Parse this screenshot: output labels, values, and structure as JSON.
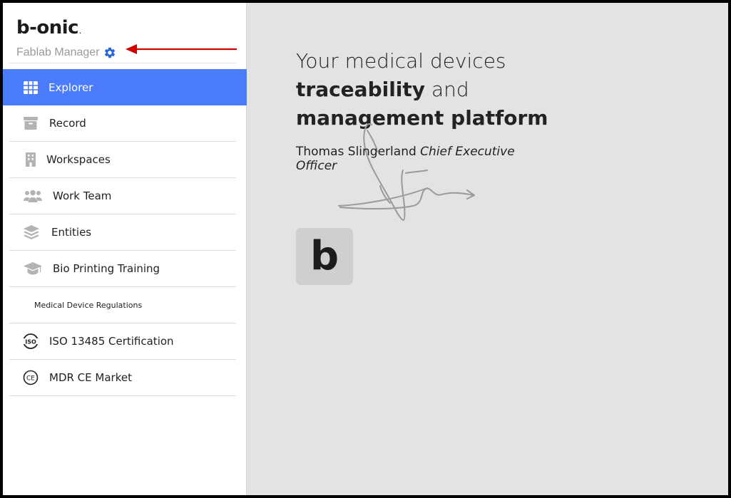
{
  "brand": {
    "logo": "b-onic",
    "logo_mark": ".",
    "org_name": "Fablab Manager"
  },
  "nav": {
    "items": [
      {
        "label": "Explorer",
        "icon": "grid-icon",
        "active": true
      },
      {
        "label": "Record",
        "icon": "archive-box-icon"
      },
      {
        "label": "Workspaces",
        "icon": "building-icon"
      },
      {
        "label": "Work Team",
        "icon": "users-icon"
      },
      {
        "label": "Entities",
        "icon": "layers-icon"
      },
      {
        "label": "Bio Printing Training",
        "icon": "graduation-cap-icon"
      }
    ],
    "section_title": "Medical Device Regulations",
    "section_items": [
      {
        "label": "ISO 13485 Certification",
        "icon": "iso-icon"
      },
      {
        "label": "MDR CE Market",
        "icon": "ce-mark-icon"
      }
    ]
  },
  "main": {
    "headline_line1": "Your medical devices",
    "headline_strong1": "traceability",
    "headline_and": " and",
    "headline_strong2": "management platform",
    "quote_author": "Thomas Slingerland ",
    "quote_role": "Chief Executive Officer",
    "logo_letter": "b"
  },
  "colors": {
    "accent": "#4b7cfc",
    "gear": "#2764d6",
    "annotation_arrow": "#d40000",
    "main_bg": "#e3e3e3"
  }
}
